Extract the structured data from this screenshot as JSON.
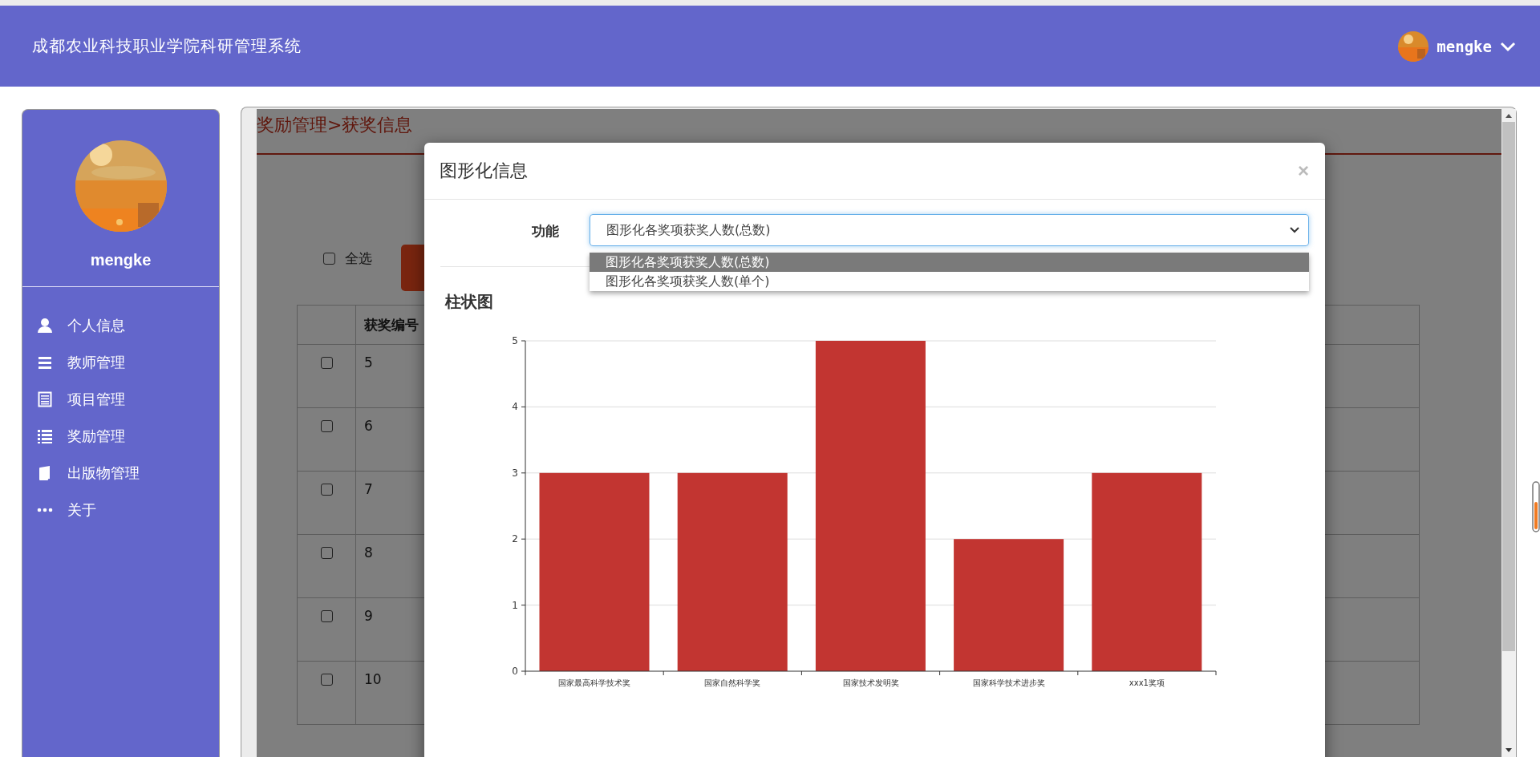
{
  "header": {
    "title": "成都农业科技职业学院科研管理系统",
    "user": "mengke"
  },
  "sidebar": {
    "profile_name": "mengke",
    "items": [
      {
        "label": "个人信息",
        "kind": "person"
      },
      {
        "label": "教师管理",
        "kind": "bars"
      },
      {
        "label": "项目管理",
        "kind": "sheet"
      },
      {
        "label": "奖励管理",
        "kind": "list"
      },
      {
        "label": "出版物管理",
        "kind": "book"
      },
      {
        "label": "关于",
        "kind": "dots"
      }
    ]
  },
  "breadcrumb": "奖励管理>获奖信息",
  "toolbar": {
    "select_all": {
      "label": "全选",
      "checked": false
    }
  },
  "table": {
    "columns": [
      "获奖编号"
    ],
    "rows": [
      {
        "checked": false,
        "cells": [
          "5"
        ]
      },
      {
        "checked": false,
        "cells": [
          "6"
        ]
      },
      {
        "checked": false,
        "cells": [
          "7"
        ]
      },
      {
        "checked": false,
        "cells": [
          "8"
        ]
      },
      {
        "checked": false,
        "cells": [
          "9"
        ]
      },
      {
        "checked": false,
        "cells": [
          "10"
        ]
      }
    ]
  },
  "modal": {
    "title": "图形化信息",
    "close": "×",
    "field_label": "功能",
    "select_value": "图形化各奖项获奖人数(总数)",
    "options": [
      {
        "label": "图形化各奖项获奖人数(总数)",
        "selected": true
      },
      {
        "label": "图形化各奖项获奖人数(单个)",
        "selected": false
      }
    ],
    "chart_title": "柱状图",
    "chart_data": {
      "type": "bar",
      "categories": [
        "国家最高科学技术奖",
        "国家自然科学奖",
        "国家技术发明奖",
        "国家科学技术进步奖",
        "xxx1奖项"
      ],
      "series": [
        {
          "color": "#c23531",
          "values": [
            3,
            3,
            5,
            2,
            3
          ]
        }
      ],
      "grid": true,
      "ylim": [
        0,
        5
      ],
      "yticks": [
        0,
        1,
        2,
        3,
        4,
        5
      ]
    }
  }
}
